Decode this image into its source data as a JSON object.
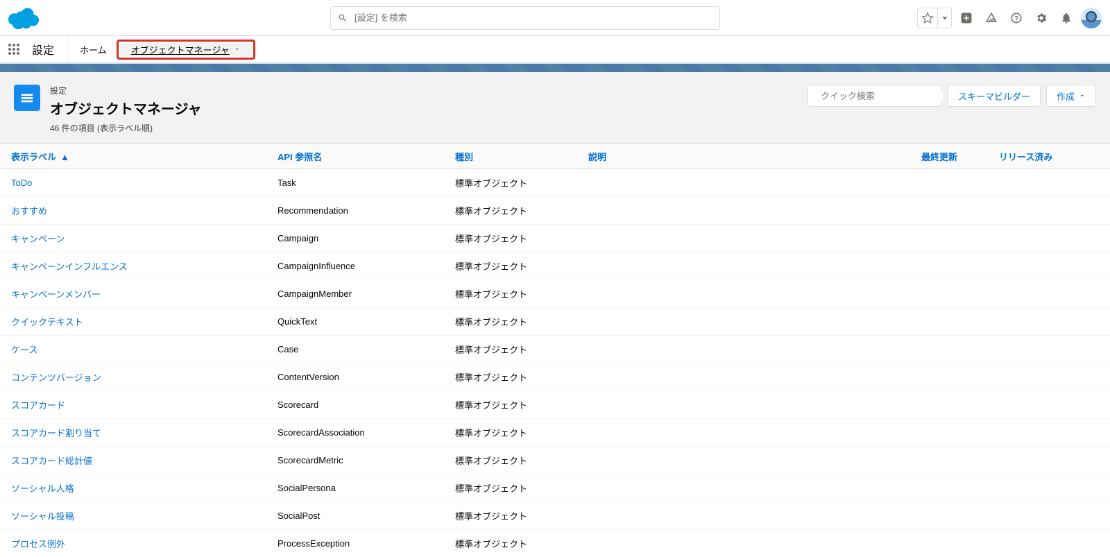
{
  "global": {
    "search_placeholder": "[設定] を検索"
  },
  "nav": {
    "app_name": "設定",
    "home": "ホーム",
    "object_manager": "オブジェクトマネージャ"
  },
  "header": {
    "crumb": "設定",
    "title": "オブジェクトマネージャ",
    "meta": "46 件の項目 (表示ラベル順)",
    "quick_find_placeholder": "クイック検索",
    "schema_builder": "スキーマビルダー",
    "create": "作成"
  },
  "table": {
    "cols": {
      "label": "表示ラベル",
      "api": "API 参照名",
      "type": "種別",
      "desc": "説明",
      "updated": "最終更新",
      "released": "リリース済み"
    },
    "rows": [
      {
        "label": "ToDo",
        "api": "Task",
        "type": "標準オブジェクト"
      },
      {
        "label": "おすすめ",
        "api": "Recommendation",
        "type": "標準オブジェクト"
      },
      {
        "label": "キャンペーン",
        "api": "Campaign",
        "type": "標準オブジェクト"
      },
      {
        "label": "キャンペーンインフルエンス",
        "api": "CampaignInfluence",
        "type": "標準オブジェクト"
      },
      {
        "label": "キャンペーンメンバー",
        "api": "CampaignMember",
        "type": "標準オブジェクト"
      },
      {
        "label": "クイックテキスト",
        "api": "QuickText",
        "type": "標準オブジェクト"
      },
      {
        "label": "ケース",
        "api": "Case",
        "type": "標準オブジェクト"
      },
      {
        "label": "コンテンツバージョン",
        "api": "ContentVersion",
        "type": "標準オブジェクト"
      },
      {
        "label": "スコアカード",
        "api": "Scorecard",
        "type": "標準オブジェクト"
      },
      {
        "label": "スコアカード割り当て",
        "api": "ScorecardAssociation",
        "type": "標準オブジェクト"
      },
      {
        "label": "スコアカード総計値",
        "api": "ScorecardMetric",
        "type": "標準オブジェクト"
      },
      {
        "label": "ソーシャル人格",
        "api": "SocialPersona",
        "type": "標準オブジェクト"
      },
      {
        "label": "ソーシャル投稿",
        "api": "SocialPost",
        "type": "標準オブジェクト"
      },
      {
        "label": "プロセス例外",
        "api": "ProcessException",
        "type": "標準オブジェクト"
      }
    ]
  }
}
